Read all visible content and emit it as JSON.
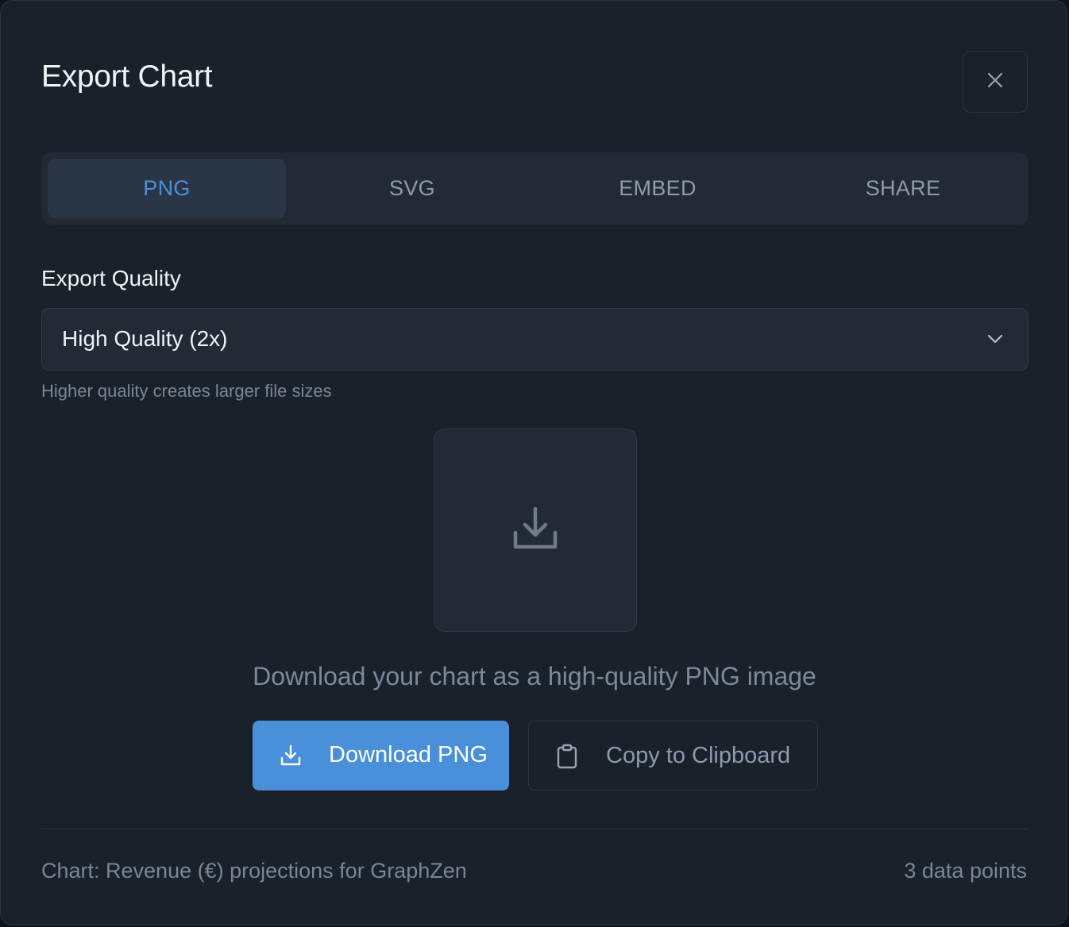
{
  "dialog": {
    "title": "Export Chart",
    "close_icon": "close-icon"
  },
  "tabs": [
    {
      "label": "PNG",
      "active": true
    },
    {
      "label": "SVG",
      "active": false
    },
    {
      "label": "EMBED",
      "active": false
    },
    {
      "label": "SHARE",
      "active": false
    }
  ],
  "quality": {
    "label": "Export Quality",
    "selected": "High Quality (2x)",
    "hint": "Higher quality creates larger file sizes",
    "chevron_icon": "chevron-down-icon"
  },
  "preview": {
    "icon": "download-icon",
    "description": "Download your chart as a high-quality PNG image"
  },
  "actions": {
    "download_label": "Download PNG",
    "download_icon": "download-icon",
    "copy_label": "Copy to Clipboard",
    "copy_icon": "clipboard-icon"
  },
  "footer": {
    "chart_info": "Chart: Revenue (€) projections for GraphZen",
    "data_points": "3 data points"
  },
  "colors": {
    "accent": "#4a8fd9",
    "background": "#1b212b",
    "surface": "#232a36",
    "text_primary": "#eef2f6",
    "text_muted": "#7b8596"
  }
}
